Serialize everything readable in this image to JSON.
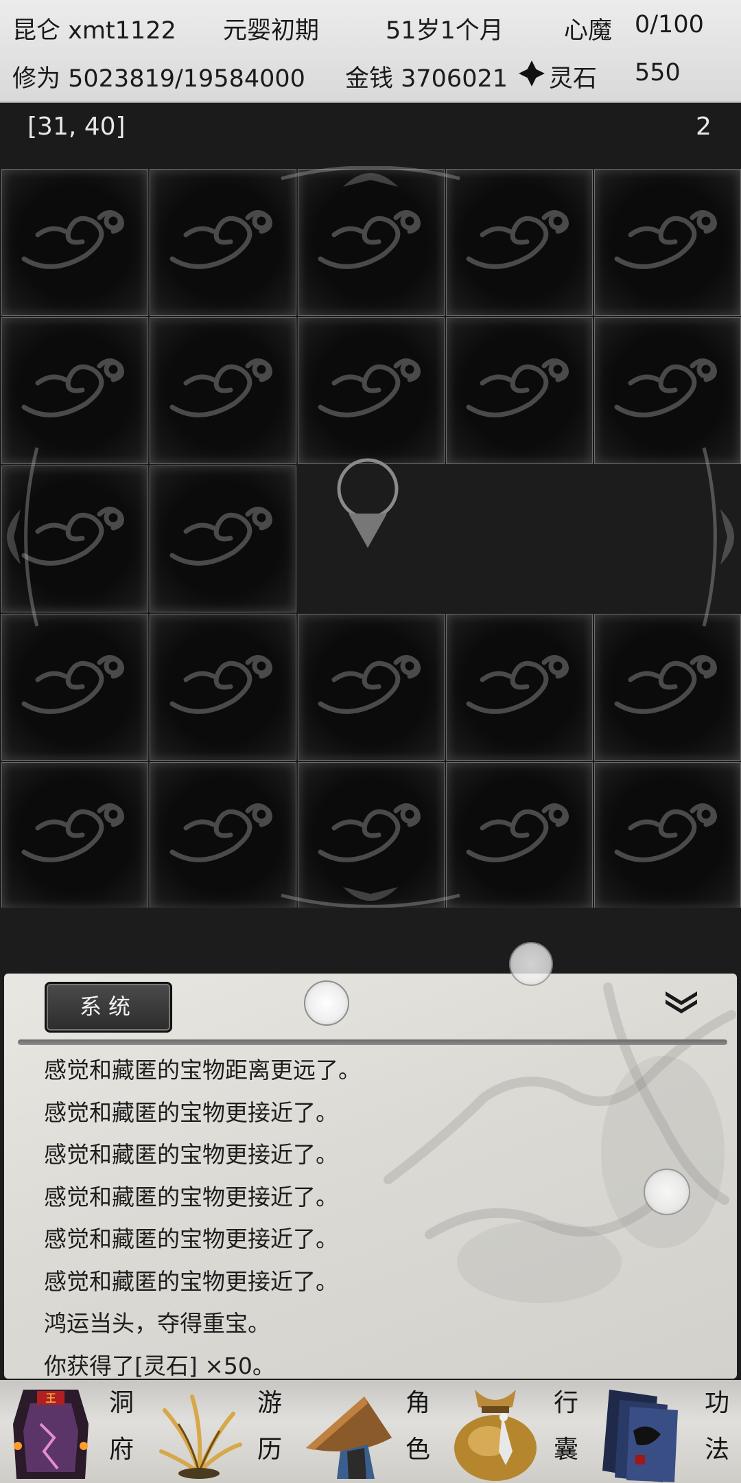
{
  "status": {
    "name": "昆仑 xmt1122",
    "realm": "元婴初期",
    "age": "51岁1个月",
    "heart_demon_label": "心魔",
    "heart_demon_value": "0/100",
    "cultivation": "修为 5023819/19584000",
    "money": "金钱 3706021",
    "spirit_stone_label": "灵石",
    "spirit_stone_value": "550"
  },
  "map": {
    "coords": "[31, 40]",
    "floor": "2"
  },
  "messages": {
    "tab_label": "系统",
    "lines": [
      "感觉和藏匿的宝物距离更远了。",
      "感觉和藏匿的宝物更接近了。",
      "感觉和藏匿的宝物更接近了。",
      "感觉和藏匿的宝物更接近了。",
      "感觉和藏匿的宝物更接近了。",
      "感觉和藏匿的宝物更接近了。",
      "鸿运当头，夺得重宝。",
      "你获得了[灵石] ×50。"
    ]
  },
  "nav": {
    "items": [
      {
        "char1": "洞",
        "char2": "府",
        "icon": "cave-building-icon"
      },
      {
        "char1": "游",
        "char2": "历",
        "icon": "grass-travel-icon"
      },
      {
        "char1": "角",
        "char2": "色",
        "icon": "straw-hat-icon"
      },
      {
        "char1": "行",
        "char2": "囊",
        "icon": "bag-icon"
      },
      {
        "char1": "功",
        "char2": "法",
        "icon": "books-icon"
      }
    ]
  },
  "colors": {
    "status_bg": "#e3e3e3",
    "map_bg": "#1c1c1c",
    "tile_border": "#6a6a6a",
    "panel_bg": "#dcdad4",
    "tab_bg": "#3a3a3a"
  }
}
